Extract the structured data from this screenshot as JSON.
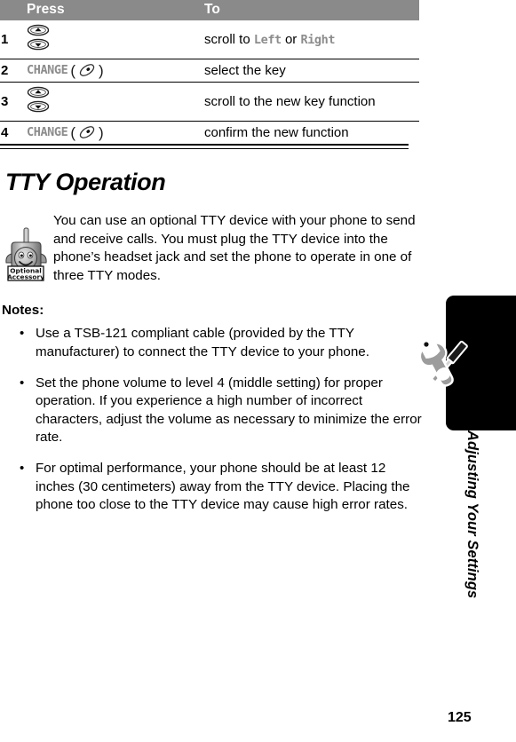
{
  "document": {
    "page_number": "125",
    "side_tab_label": "Adjusting Your Settings"
  },
  "steps_table": {
    "headers": {
      "num": "",
      "press": "Press",
      "to": "To"
    },
    "rows": [
      {
        "num": "1",
        "press_type": "scroll-key",
        "press_label": "",
        "to": "scroll to ",
        "to_code_1": "Left",
        "to_mid": " or ",
        "to_code_2": "Right"
      },
      {
        "num": "2",
        "press_type": "softkey",
        "press_label": "CHANGE",
        "to": "select the key"
      },
      {
        "num": "3",
        "press_type": "scroll-key",
        "press_label": "",
        "to": "scroll to the new key function"
      },
      {
        "num": "4",
        "press_type": "softkey",
        "press_label": "CHANGE",
        "to": "confirm the new function"
      }
    ]
  },
  "section": {
    "title": "TTY Operation",
    "accessory_icon_line1": "Optional",
    "accessory_icon_line2": "Accessory",
    "intro": "You can use an optional TTY device with your phone to send and receive calls. You must plug the TTY device into the phone’s headset jack and set the phone to operate in one of three TTY modes.",
    "notes_label": "Notes:",
    "bullet_marker": "•",
    "notes": [
      "Use a TSB-121 compliant cable (provided by the TTY manufacturer) to connect the TTY device to your phone.",
      "Set the phone volume to level 4 (middle setting) for proper operation. If you experience a high number of incorrect characters, adjust the volume as necessary to minimize the error rate.",
      "For optimal performance, your phone should be at least 12 inches (30 centimeters) away from the TTY device. Placing the phone too close to the TTY device may cause high error rates."
    ]
  },
  "colors": {
    "header_bar": "#8a8a8a",
    "display_font": "#8c8c8c",
    "tab_black": "#000000"
  }
}
